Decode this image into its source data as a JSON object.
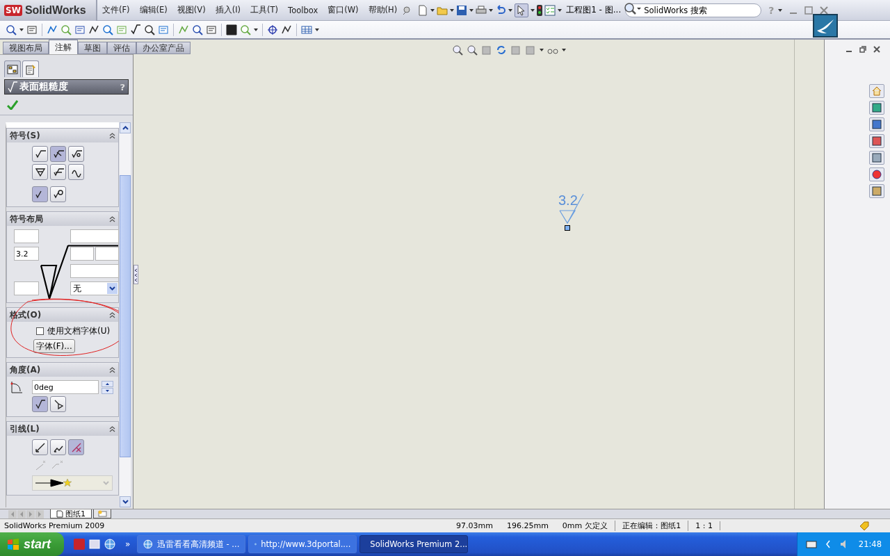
{
  "app": {
    "logo_badge": "SW",
    "logo_text": "SolidWorks"
  },
  "menu": [
    "文件(F)",
    "编辑(E)",
    "视图(V)",
    "插入(I)",
    "工具(T)",
    "Toolbox",
    "窗口(W)",
    "帮助(H)"
  ],
  "document_title": "工程图1 - 图...",
  "search": {
    "placeholder": "SolidWorks 搜索"
  },
  "help_mark": "?",
  "command_tabs": [
    {
      "label": "视图布局",
      "selected": false
    },
    {
      "label": "注解",
      "selected": true
    },
    {
      "label": "草图",
      "selected": false
    },
    {
      "label": "评估",
      "selected": false
    },
    {
      "label": "办公室产品",
      "selected": false
    }
  ],
  "panel_tabs": [
    {
      "selected": false
    },
    {
      "selected": true
    }
  ],
  "property_manager": {
    "title": "表面粗糙度",
    "help": "?",
    "sections": [
      {
        "kind": "symbols",
        "title": "符号(S)",
        "expanded": true,
        "rows": [
          [
            {
              "selected": false
            },
            {
              "selected": true
            },
            {
              "selected": false
            }
          ],
          [
            {
              "selected": false
            },
            {
              "selected": false
            },
            {
              "selected": false
            }
          ],
          [
            {
              "selected": true
            },
            {
              "selected": false
            }
          ]
        ]
      },
      {
        "kind": "layout",
        "title": "符号布局",
        "expanded": true,
        "value": "3.2",
        "lay": "无"
      },
      {
        "kind": "format",
        "title": "格式(O)",
        "expanded": true,
        "checkbox": {
          "label": "使用文档字体(U)",
          "checked": false
        },
        "button": "字体(F)..."
      },
      {
        "kind": "angle",
        "title": "角度(A)",
        "expanded": true,
        "value": "0deg",
        "buttons": [
          {
            "selected": true
          },
          {
            "selected": false
          }
        ]
      },
      {
        "kind": "leader",
        "title": "引线(L)",
        "expanded": true,
        "buttons": [
          {
            "selected": false
          },
          {
            "selected": false
          },
          {
            "selected": true
          }
        ]
      }
    ]
  },
  "drawing": {
    "roughness_label": "3.2"
  },
  "sheet_tabs": [
    {
      "label": "图纸1",
      "selected": true
    }
  ],
  "status_bar": {
    "product": "SolidWorks Premium 2009",
    "x": "97.03mm",
    "y": "196.25mm",
    "z": "0mm",
    "state": "欠定义",
    "editing": "正在编辑：图纸1",
    "scale": "1 : 1"
  },
  "taskbar": {
    "start": "start",
    "chevron": "»",
    "tasks": [
      {
        "label": "迅雷看看高清频道 - ...",
        "selected": false,
        "kind": "browser"
      },
      {
        "label": "http://www.3dportal....",
        "selected": false,
        "kind": "browser"
      },
      {
        "label": "SolidWorks Premium 2...",
        "selected": true,
        "kind": "app"
      }
    ],
    "clock": "21:48"
  }
}
